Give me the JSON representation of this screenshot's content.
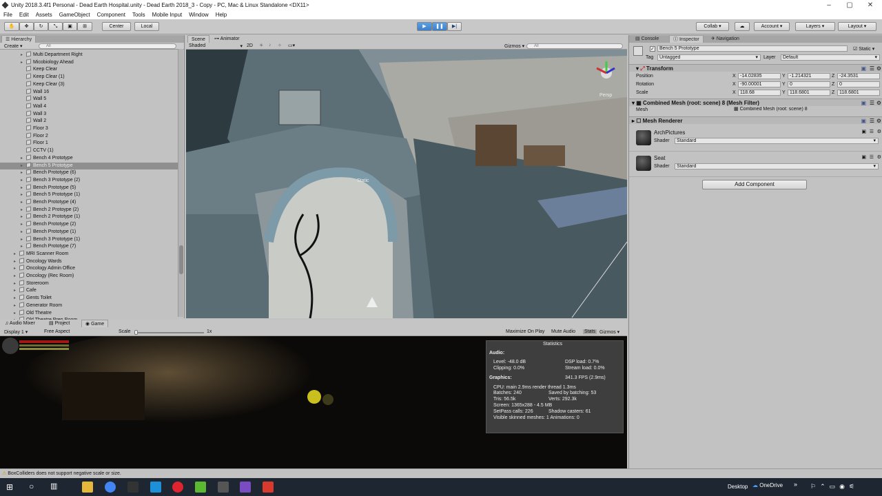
{
  "window": {
    "title": "Unity 2018.3.4f1 Personal - Dead Earth Hospital.unity - Dead Earth 2018_3 - Copy - PC, Mac & Linux Standalone <DX11>"
  },
  "menu": [
    "File",
    "Edit",
    "Assets",
    "GameObject",
    "Component",
    "Tools",
    "Mobile Input",
    "Window",
    "Help"
  ],
  "toolbar": {
    "center": "Center",
    "local": "Local",
    "collab": "Collab ▾",
    "account": "Account",
    "layers": "Layers",
    "layout": "Layout"
  },
  "hierarchy": {
    "tab": "Hierarchy",
    "create": "Create ▾",
    "search_placeholder": "All",
    "items": [
      {
        "label": "Multi Department Right",
        "depth": 1,
        "arrow": true
      },
      {
        "label": "Micobiology Ahead",
        "depth": 1,
        "arrow": true
      },
      {
        "label": "Keep Clear",
        "depth": 1
      },
      {
        "label": "Keep Clear (1)",
        "depth": 1
      },
      {
        "label": "Keep Clear (3)",
        "depth": 1
      },
      {
        "label": "Wall 16",
        "depth": 1
      },
      {
        "label": "Wall 5",
        "depth": 1
      },
      {
        "label": "Wall 4",
        "depth": 1
      },
      {
        "label": "Wall 3",
        "depth": 1
      },
      {
        "label": "Wall 2",
        "depth": 1
      },
      {
        "label": "Floor 3",
        "depth": 1
      },
      {
        "label": "Floor 2",
        "depth": 1
      },
      {
        "label": "Floor 1",
        "depth": 1
      },
      {
        "label": "CCTV (1)",
        "depth": 1
      },
      {
        "label": "Bench 4 Prototype",
        "depth": 1,
        "arrow": true
      },
      {
        "label": "Bench 5 Prototype",
        "depth": 1,
        "arrow": true,
        "selected": true
      },
      {
        "label": "Bench Prototype (6)",
        "depth": 1,
        "arrow": true
      },
      {
        "label": "Bench 3 Prototype (2)",
        "depth": 1,
        "arrow": true
      },
      {
        "label": "Bench Prototype (5)",
        "depth": 1,
        "arrow": true
      },
      {
        "label": "Bench 5 Prototype (1)",
        "depth": 1,
        "arrow": true
      },
      {
        "label": "Bench Prototype (4)",
        "depth": 1,
        "arrow": true
      },
      {
        "label": "Bench 2 Protoype (2)",
        "depth": 1,
        "arrow": true
      },
      {
        "label": "Bench 2 Prototype (1)",
        "depth": 1,
        "arrow": true
      },
      {
        "label": "Bench Prototype (2)",
        "depth": 1,
        "arrow": true
      },
      {
        "label": "Bench Prototype (1)",
        "depth": 1,
        "arrow": true
      },
      {
        "label": "Bench 3 Prototype (1)",
        "depth": 1,
        "arrow": true
      },
      {
        "label": "Bench Prototype (7)",
        "depth": 1,
        "arrow": true
      },
      {
        "label": "MRI Scanner Room",
        "depth": 0,
        "arrow": true
      },
      {
        "label": "Oncology Wards",
        "depth": 0,
        "arrow": true
      },
      {
        "label": "Oncology Admin Office",
        "depth": 0,
        "arrow": true
      },
      {
        "label": "Oncology (Rec Room)",
        "depth": 0,
        "arrow": true
      },
      {
        "label": "Storeroom",
        "depth": 0,
        "arrow": true
      },
      {
        "label": "Cafe",
        "depth": 0,
        "arrow": true
      },
      {
        "label": "Gents Toilet",
        "depth": 0,
        "arrow": true
      },
      {
        "label": "Generator Room",
        "depth": 0,
        "arrow": true
      },
      {
        "label": "Old Theatre",
        "depth": 0,
        "arrow": true
      },
      {
        "label": "Old Theatre Prep Room",
        "depth": 0,
        "arrow": true
      }
    ]
  },
  "scene": {
    "tab": "Scene",
    "tab2": "Animator",
    "shaded": "Shaded",
    "mode2d": "2D",
    "gizmos": "Gizmos ▾",
    "search_placeholder": "All",
    "persp": "Persp",
    "static_label": "Static"
  },
  "game": {
    "tabs": [
      "Audio Mixer",
      "Project",
      "Game"
    ],
    "display": "Display 1 ▾",
    "aspect": "Free Aspect",
    "scale_label": "Scale",
    "scale_val": "1x",
    "maximize": "Maximize On Play",
    "mute": "Mute Audio",
    "stats": "Stats",
    "gizmos": "Gizmos ▾"
  },
  "stats": {
    "title": "Statistics",
    "audio": "Audio:",
    "level": "Level: -48.0 dB",
    "clipping": "Clipping: 0.0%",
    "dsp": "DSP load: 0.7%",
    "stream": "Stream load: 0.0%",
    "graphics": "Graphics:",
    "fps": "341.3 FPS (2.9ms)",
    "cpu": "CPU: main 2.9ms  render thread 1.3ms",
    "batches": "Batches: 240",
    "saved": "Saved by batching: 53",
    "tris": "Tris: 56.5k",
    "verts": "Verts: 292.3k",
    "screen": "Screen: 1365x288 - 4.5 MB",
    "setpass": "SetPass calls: 226",
    "shadow": "Shadow casters: 61",
    "skinned": "Visible skinned meshes: 1  Animations: 0"
  },
  "inspector": {
    "tabs": [
      "Console",
      "Inspector",
      "Navigation"
    ],
    "object_name": "Bench 5 Prototype",
    "static": "Static",
    "tag_label": "Tag",
    "tag": "Untagged",
    "layer_label": "Layer",
    "layer": "Default",
    "transform": "Transform",
    "rows": [
      {
        "label": "Position",
        "x": "-14.02835",
        "y": "-1.214321",
        "z": "-24.3531"
      },
      {
        "label": "Rotation",
        "x": "-90.00001",
        "y": "0",
        "z": "0"
      },
      {
        "label": "Scale",
        "x": "118.68",
        "y": "118.6801",
        "z": "118.6801"
      }
    ],
    "meshfilter": "Combined Mesh (root: scene) 8 (Mesh Filter)",
    "mesh_label": "Mesh",
    "mesh_value": "Combined Mesh (root: scene) 8",
    "meshrenderer": "Mesh Renderer",
    "materials": [
      {
        "name": "ArchPictures",
        "shader": "Standard"
      },
      {
        "name": "Seat",
        "shader": "Standard"
      }
    ],
    "shader_label": "Shader",
    "add_component": "Add Component"
  },
  "status": "BoxColliders does not support negative scale or size.",
  "taskbar": {
    "desktop": "Desktop",
    "onedrive": "OneDrive"
  }
}
